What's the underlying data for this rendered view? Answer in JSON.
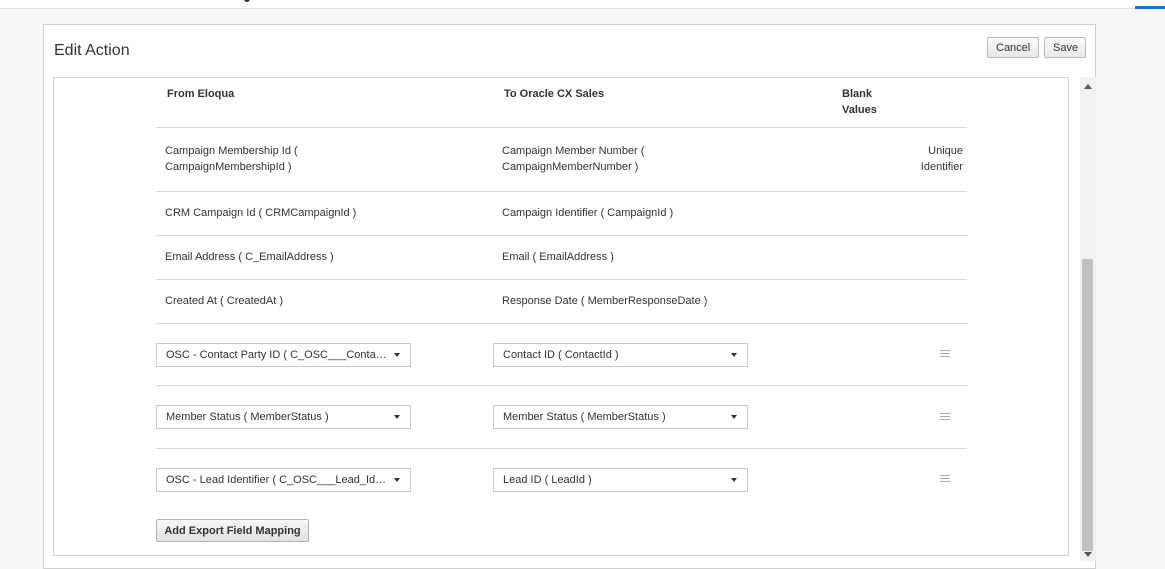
{
  "dialog": {
    "title": "Edit Action",
    "cancel_label": "Cancel",
    "save_label": "Save"
  },
  "table": {
    "headers": {
      "from": "From Eloqua",
      "to": "To Oracle CX Sales",
      "blank": "Blank Values"
    },
    "static_rows": [
      {
        "from": "Campaign Membership Id ( CampaignMembershipId )",
        "to": "Campaign Member Number ( CampaignMemberNumber )",
        "blank": "Unique Identifier"
      },
      {
        "from": "CRM Campaign Id ( CRMCampaignId )",
        "to": "Campaign Identifier ( CampaignId )",
        "blank": ""
      },
      {
        "from": "Email Address ( C_EmailAddress )",
        "to": "Email ( EmailAddress )",
        "blank": ""
      },
      {
        "from": "Created At ( CreatedAt )",
        "to": "Response Date ( MemberResponseDate )",
        "blank": ""
      }
    ],
    "mapped_rows": [
      {
        "from": "OSC - Contact Party ID ( C_OSC___Contact_Party_ID )",
        "to": "Contact ID ( ContactId )"
      },
      {
        "from": "Member Status ( MemberStatus )",
        "to": "Member Status ( MemberStatus )"
      },
      {
        "from": "OSC - Lead Identifier ( C_OSC___Lead_Identifier )",
        "to": "Lead ID ( LeadId )"
      }
    ]
  },
  "add_mapping_label": "Add Export Field Mapping",
  "icons": {
    "drag": "drag-handle-icon",
    "caret": "chevron-down-icon",
    "scroll_up": "scroll-up-arrow-icon",
    "scroll_down": "scroll-down-arrow-icon"
  },
  "colors": {
    "accent": "#1a73c7",
    "border": "#d9d9d9"
  }
}
